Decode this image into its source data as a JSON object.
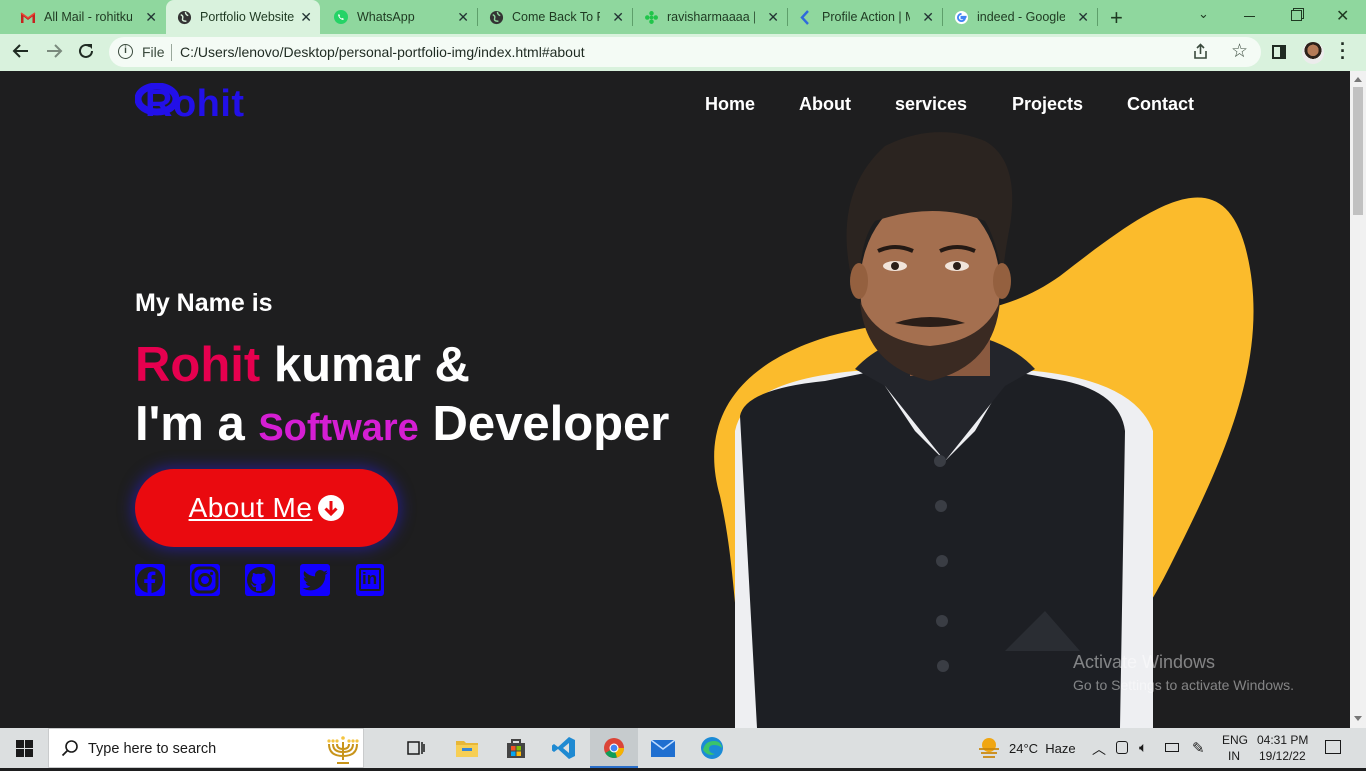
{
  "browser": {
    "tabs": [
      {
        "label": "All Mail - rohitku",
        "icon": "gmail-icon"
      },
      {
        "label": "Portfolio Website",
        "icon": "globe-icon",
        "active": true
      },
      {
        "label": "WhatsApp",
        "icon": "whatsapp-icon"
      },
      {
        "label": "Come Back To Po",
        "icon": "globe-icon"
      },
      {
        "label": "ravisharmaaaa | I",
        "icon": "flower-icon"
      },
      {
        "label": "Profile Action | M",
        "icon": "kotlin-icon"
      },
      {
        "label": "indeed - Google",
        "icon": "google-icon"
      }
    ],
    "address": {
      "scheme": "File",
      "url": "C:/Users/lenovo/Desktop/personal-portfolio-img/index.html#about"
    }
  },
  "site": {
    "logo": "Rohit",
    "nav": [
      "Home",
      "About",
      "services",
      "Projects",
      "Contact"
    ],
    "hero": {
      "intro": "My Name is",
      "first_name": "Rohit",
      "name_rest": "kumar &",
      "role_prefix": "I'm a",
      "role_highlight": "Software",
      "role_rest": "Developer",
      "cta": "About Me"
    },
    "social": [
      "facebook-icon",
      "instagram-icon",
      "github-icon",
      "twitter-icon",
      "linkedin-icon"
    ],
    "social_text": {
      "linkedin": "in"
    },
    "colors": {
      "accent_red": "#e6004f",
      "accent_magenta": "#d51ed3",
      "blob": "#fbbb2c",
      "button": "#ea0a0f",
      "logo": "#2210e8"
    }
  },
  "watermark": {
    "title": "Activate Windows",
    "subtitle": "Go to Settings to activate Windows."
  },
  "taskbar": {
    "search_placeholder": "Type here to search",
    "weather": "24°C  Haze",
    "lang1": "ENG",
    "lang2": "IN",
    "time": "04:31 PM",
    "date": "19/12/22"
  }
}
